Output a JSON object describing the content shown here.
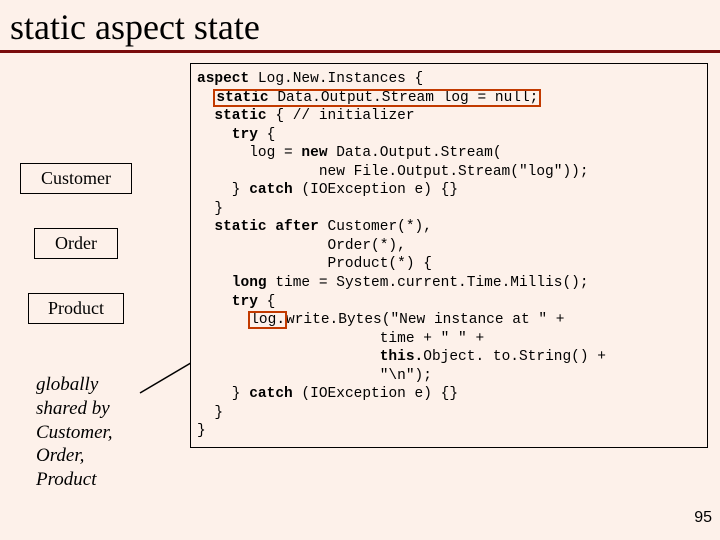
{
  "title": "static aspect state",
  "uml": {
    "customer": "Customer",
    "order": "Order",
    "product": "Product"
  },
  "annotation": {
    "l1": "globally",
    "l2": "shared by",
    "l3": "Customer,",
    "l4": "Order,",
    "l5": "Product"
  },
  "code": {
    "l01a": "aspect",
    "l01b": " Log.New.Instances {",
    "l02a": "  ",
    "l02hl_kw": "static",
    "l02hl_rest": " Data.Output.Stream log = null;",
    "l03a": "  static",
    "l03b": " { // initializer",
    "l04a": "    try",
    "l04b": " {",
    "l05a": "      log = ",
    "l05b": "new",
    "l05c": " Data.Output.Stream(",
    "l06": "              new File.Output.Stream(\"log\"));",
    "l07a": "    } ",
    "l07b": "catch",
    "l07c": " (IOException e) {}",
    "l08": "  }",
    "l09a": "  static after",
    "l09b": " Customer(*),",
    "l10": "               Order(*),",
    "l11": "               Product(*) {",
    "l12a": "    long",
    "l12b": " time = System.current.Time.Millis();",
    "l13a": "    try",
    "l13b": " {",
    "l14a": "      ",
    "l14hl": "log.",
    "l14b": "write.Bytes(\"New instance at \" +",
    "l15": "                     time + \" \" +",
    "l16a": "                     ",
    "l16b": "this.",
    "l16c": "Object. to.String() +",
    "l17": "                     \"\\n\");",
    "l18a": "    } ",
    "l18b": "catch",
    "l18c": " (IOException e) {}",
    "l19": "  }",
    "l20": "}"
  },
  "page_number": "95"
}
